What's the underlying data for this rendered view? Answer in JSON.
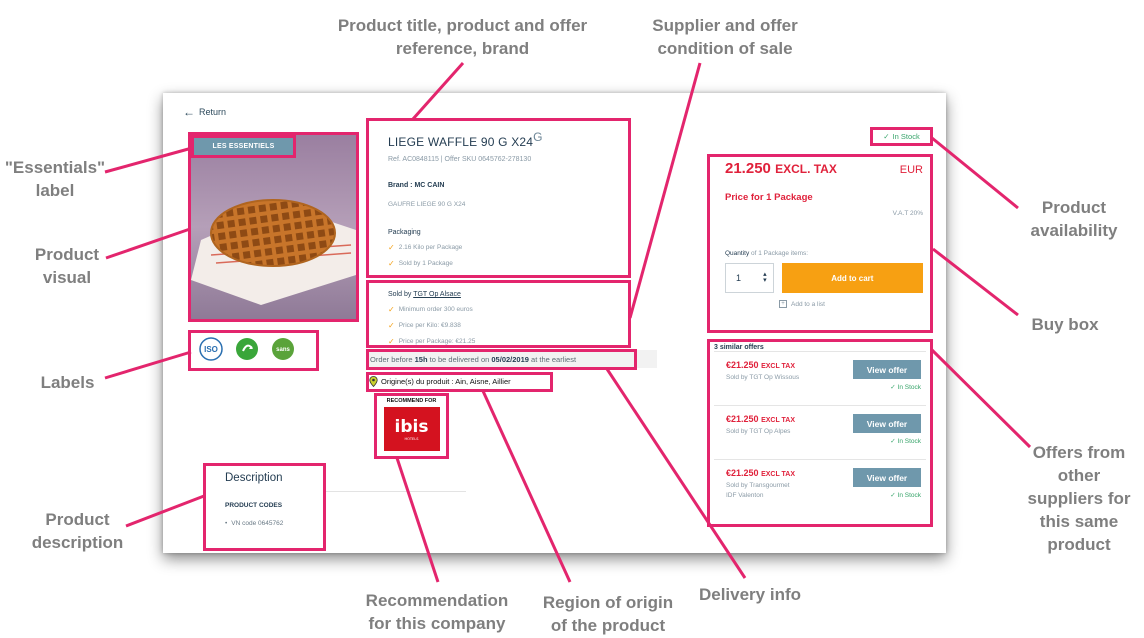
{
  "app": {
    "return_label": "Return"
  },
  "product": {
    "essentials_badge": "LES ESSENTIELS",
    "title": "LIEGE WAFFLE 90 G X24",
    "title_mark": "G",
    "reference": "Ref. AC0848115 | Offer SKU 0645762-278130",
    "brand": "Brand : MC CAIN",
    "description_line": "GAUFRE LIEGE 90 G X24",
    "packaging_header": "Packaging",
    "packaging": [
      "2.16 Kilo per Package",
      "Sold by 1 Package"
    ],
    "labels": [
      "iso-certification-icon",
      "recycle-icon",
      "sans-additive-icon"
    ]
  },
  "supplier": {
    "sold_by_prefix": "Sold by",
    "sold_by_name": "TGT Op Alsace",
    "conditions": [
      "Minimum order 300 euros",
      "Price per Kilo: €9.838",
      "Price per Package: €21.25"
    ]
  },
  "delivery": {
    "before": "Order before",
    "hour": "15h",
    "middle": "to be delivered on",
    "date": "05/02/2019",
    "after": "at the earliest"
  },
  "origin": {
    "text": "Origine(s) du produit : Ain, Aisne, Aillier"
  },
  "recommend": {
    "label": "RECOMMEND FOR",
    "logo_text": "ibis",
    "logo_sub": "HOTELS"
  },
  "description": {
    "title": "Description",
    "codes_header": "PRODUCT CODES",
    "vn_code": "VN code 0645762"
  },
  "availability": {
    "text": "In Stock"
  },
  "buy_box": {
    "price": "21.250",
    "price_suffix": "EXCL. TAX",
    "currency": "EUR",
    "price_for": "Price for 1 Package",
    "vat": "V.A.T 20%",
    "qty_label": "Quantity",
    "qty_sub": "of 1 Package items:",
    "qty_value": "1",
    "add_to_cart": "Add to cart",
    "add_to_list": "Add to a list"
  },
  "offers": {
    "header": "3 similar offers",
    "items": [
      {
        "price": "€21.250",
        "suffix": "EXCL TAX",
        "seller": "Sold by TGT Op Wissous",
        "seller2": "",
        "button": "View offer",
        "stock": "In Stock"
      },
      {
        "price": "€21.250",
        "suffix": "EXCL TAX",
        "seller": "Sold by TGT Op Alpes",
        "seller2": "",
        "button": "View offer",
        "stock": "In Stock"
      },
      {
        "price": "€21.250",
        "suffix": "EXCL TAX",
        "seller": "Sold by Transgourmet",
        "seller2": "IDF Valenton",
        "button": "View offer",
        "stock": "In Stock"
      }
    ]
  },
  "annotations": {
    "title_ref": [
      "Product title, product and offer",
      "reference, brand"
    ],
    "supplier": [
      "Supplier and offer",
      "condition of sale"
    ],
    "essentials": [
      "\"Essentials\"",
      "label"
    ],
    "visual": [
      "Product",
      "visual"
    ],
    "labels": [
      "Labels"
    ],
    "description": [
      "Product",
      "description"
    ],
    "recommendation": [
      "Recommendation",
      "for this company"
    ],
    "origin": [
      "Region of origin",
      "of the product"
    ],
    "delivery": [
      "Delivery info"
    ],
    "availability": [
      "Product",
      "availability"
    ],
    "buy_box": [
      "Buy box"
    ],
    "offers": [
      "Offers from",
      "other",
      "suppliers for",
      "this same",
      "product"
    ]
  },
  "colors": {
    "annotation_pink": "#e3256d",
    "annotation_text": "#7f7f7f",
    "price_red": "#e0213b",
    "cart_orange": "#f7a012",
    "offer_blue": "#6f98ac",
    "stock_green": "#37a46a"
  }
}
